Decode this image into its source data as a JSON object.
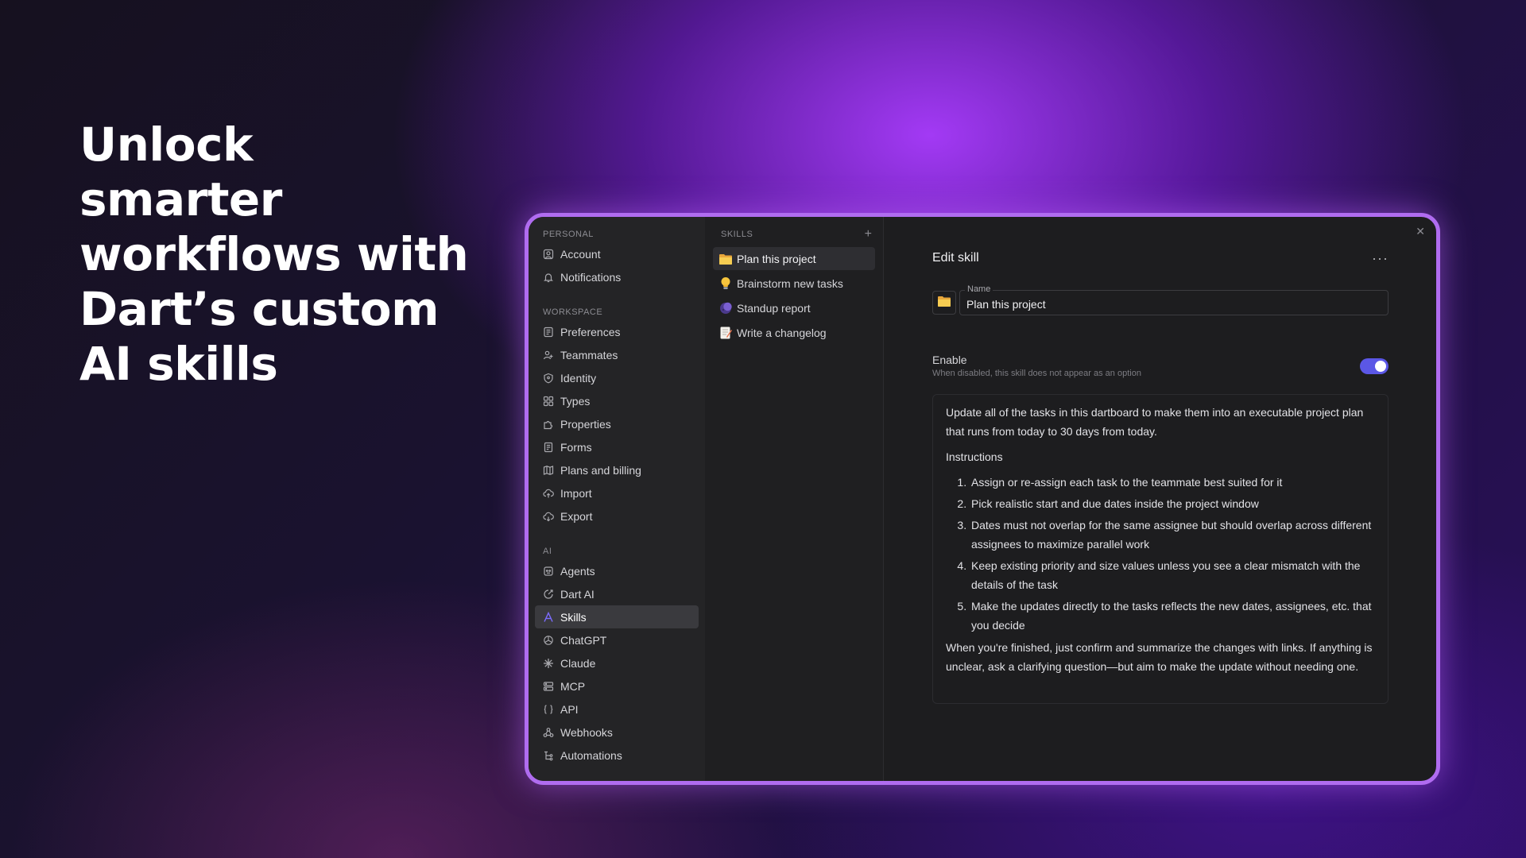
{
  "hero": {
    "line1": "Unlock",
    "line2": "smarter",
    "line3": "workflows with",
    "line4": "Dart’s custom",
    "line5": "AI skills"
  },
  "sidebar": {
    "personal_title": "PERSONAL",
    "personal_items": [
      {
        "label": "Account",
        "icon": "account-icon"
      },
      {
        "label": "Notifications",
        "icon": "bell-icon"
      }
    ],
    "workspace_title": "WORKSPACE",
    "workspace_items": [
      {
        "label": "Preferences",
        "icon": "preferences-icon"
      },
      {
        "label": "Teammates",
        "icon": "teammates-icon"
      },
      {
        "label": "Identity",
        "icon": "shield-icon"
      },
      {
        "label": "Types",
        "icon": "grid-icon"
      },
      {
        "label": "Properties",
        "icon": "puzzle-icon"
      },
      {
        "label": "Forms",
        "icon": "form-icon"
      },
      {
        "label": "Plans and billing",
        "icon": "map-icon"
      },
      {
        "label": "Import",
        "icon": "cloud-upload-icon"
      },
      {
        "label": "Export",
        "icon": "cloud-download-icon"
      }
    ],
    "ai_title": "AI",
    "ai_items": [
      {
        "label": "Agents",
        "icon": "agent-icon"
      },
      {
        "label": "Dart AI",
        "icon": "dart-ai-icon"
      },
      {
        "label": "Skills",
        "icon": "skills-icon",
        "active": true
      },
      {
        "label": "ChatGPT",
        "icon": "chatgpt-icon"
      },
      {
        "label": "Claude",
        "icon": "claude-icon"
      },
      {
        "label": "MCP",
        "icon": "server-icon"
      },
      {
        "label": "API",
        "icon": "braces-icon"
      },
      {
        "label": "Webhooks",
        "icon": "webhook-icon"
      },
      {
        "label": "Automations",
        "icon": "automation-icon"
      }
    ]
  },
  "skills": {
    "title": "SKILLS",
    "add_label": "+",
    "items": [
      {
        "label": "Plan this project",
        "icon": "folder-icon",
        "active": true
      },
      {
        "label": "Brainstorm new tasks",
        "icon": "lightbulb-icon"
      },
      {
        "label": "Standup report",
        "icon": "moon-icon"
      },
      {
        "label": "Write a changelog",
        "icon": "memo-icon"
      }
    ]
  },
  "editor": {
    "title": "Edit skill",
    "more_label": "···",
    "close_label": "✕",
    "name_label": "Name",
    "name_value": "Plan this project",
    "enable_label": "Enable",
    "enable_desc": "When disabled, this skill does not appear as an option",
    "enabled": true,
    "prompt_intro": "Update all of the tasks in this dartboard to make them into an executable project plan that runs from today to 30 days from today.",
    "instructions_title": "Instructions",
    "steps": [
      "Assign or re-assign each task to the teammate best suited for it",
      "Pick realistic start and due dates inside the project window",
      "Dates must not overlap for the same assignee but should overlap across different assignees to maximize parallel work",
      "Keep existing priority and size values unless you see a clear mismatch with the details of the task",
      "Make the updates directly to the tasks reflects the new dates, assignees, etc. that you decide"
    ],
    "prompt_outro": "When you're finished, just confirm and summarize the changes with links. If anything is unclear, ask a clarifying question—but aim to make the update without needing one."
  },
  "colors": {
    "accent": "#5b57e6",
    "border_glow": "#b06cf0"
  }
}
